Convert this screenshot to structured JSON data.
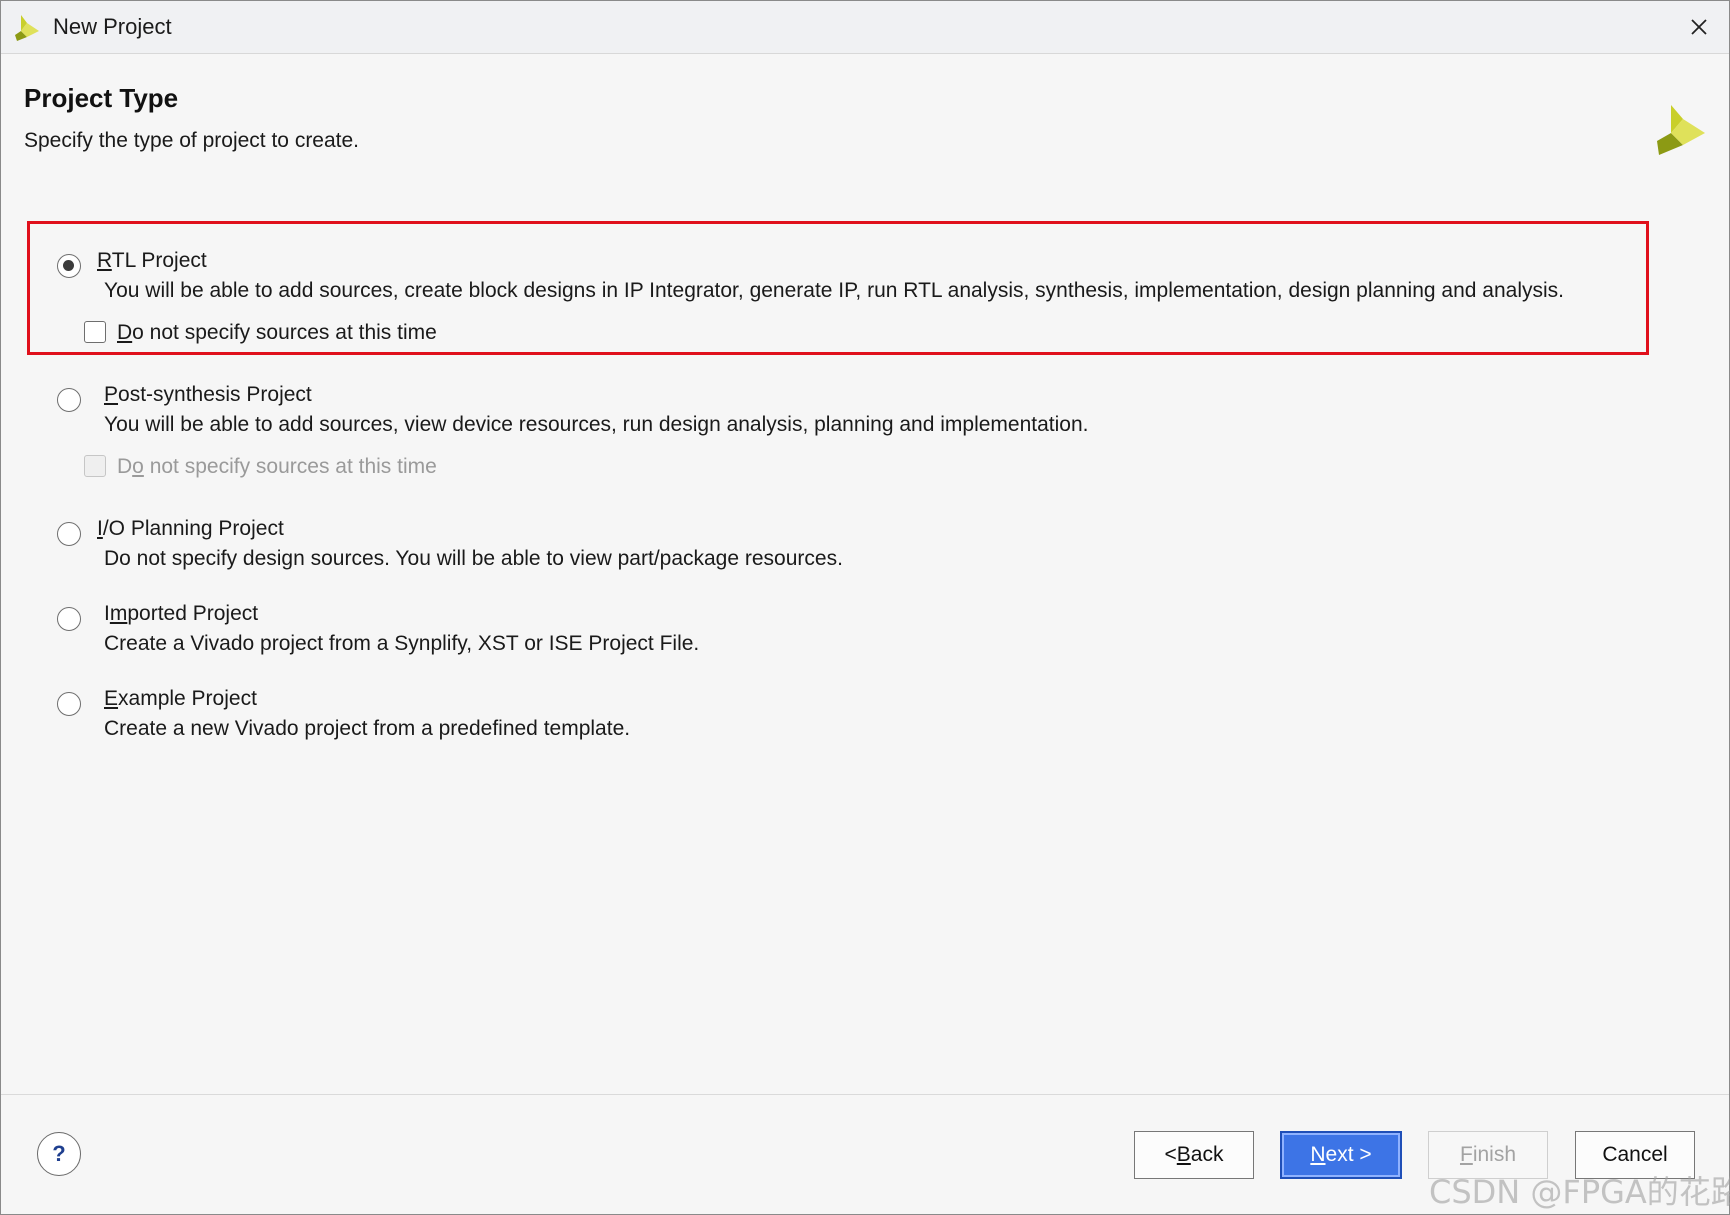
{
  "window": {
    "title": "New Project",
    "app_icon": "xilinx-logo-icon",
    "close_icon": "close-icon"
  },
  "header": {
    "title": "Project Type",
    "subtitle": "Specify the type of project to create.",
    "logo": "vivado-logo-icon"
  },
  "options": [
    {
      "label_mnemonic": "R",
      "label_rest": "TL Project",
      "selected": true,
      "description": "You will be able to add sources, create block designs in IP Integrator, generate IP, run RTL analysis, synthesis, implementation, design planning and analysis.",
      "checkbox": {
        "label_mnemonic": "D",
        "label_rest": "o not specify sources at this time",
        "checked": false,
        "enabled": true
      }
    },
    {
      "label_mnemonic": "P",
      "label_rest": "ost-synthesis Project",
      "selected": false,
      "description": "You will be able to add sources, view device resources, run design analysis, planning and implementation.",
      "checkbox": {
        "label_pre": "D",
        "label_mnemonic": "o",
        "label_rest": " not specify sources at this time",
        "checked": false,
        "enabled": false
      }
    },
    {
      "label_mnemonic": "I",
      "label_rest": "/O Planning Project",
      "selected": false,
      "description": "Do not specify design sources. You will be able to view part/package resources."
    },
    {
      "label_pre": "I",
      "label_mnemonic": "m",
      "label_rest": "ported Project",
      "selected": false,
      "description": "Create a Vivado project from a Synplify, XST or ISE Project File."
    },
    {
      "label_mnemonic": "E",
      "label_rest": "xample Project",
      "selected": false,
      "description": "Create a new Vivado project from a predefined template."
    }
  ],
  "footer": {
    "help_label": "?",
    "back": {
      "pre": "< ",
      "mnemonic": "B",
      "rest": "ack"
    },
    "next": {
      "mnemonic": "N",
      "rest": "ext >"
    },
    "finish": {
      "mnemonic": "F",
      "rest": "inish"
    },
    "cancel": "Cancel"
  },
  "watermark": "CSDN @FPGA的花路"
}
